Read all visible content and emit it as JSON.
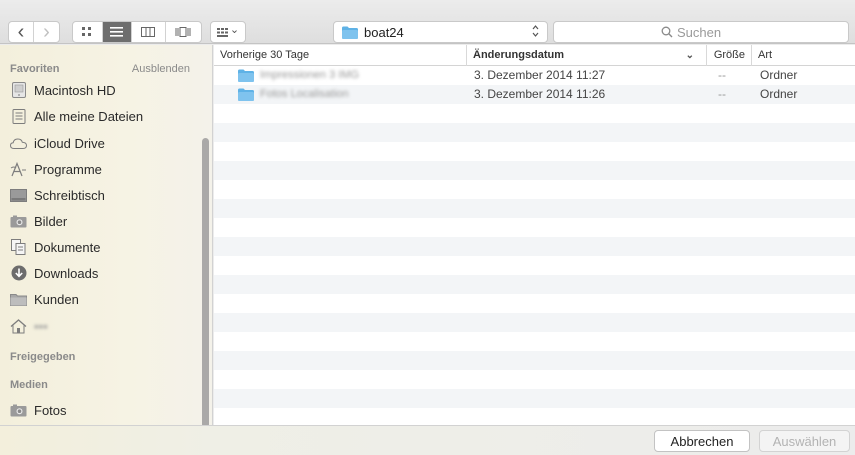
{
  "toolbar": {
    "back_glyph": "‹",
    "forward_glyph": "›",
    "view_icons": [
      "icon-view-icon",
      "list-view-icon",
      "column-view-icon",
      "coverflow-view-icon"
    ],
    "arrange_icon": "arrange-icon",
    "arrange_chevron": "⌄",
    "location": "boat24",
    "location_updown": "⌃⌄",
    "search_placeholder": "Suchen"
  },
  "sidebar": {
    "favorites_header": "Favoriten",
    "hide_label": "Ausblenden",
    "favorites": [
      {
        "label": "Macintosh HD",
        "icon": "hard-drive-icon"
      },
      {
        "label": "Alle meine Dateien",
        "icon": "all-files-icon"
      },
      {
        "label": "iCloud Drive",
        "icon": "cloud-icon"
      },
      {
        "label": "Programme",
        "icon": "applications-icon"
      },
      {
        "label": "Schreibtisch",
        "icon": "desktop-icon"
      },
      {
        "label": "Bilder",
        "icon": "camera-icon"
      },
      {
        "label": "Dokumente",
        "icon": "documents-icon"
      },
      {
        "label": "Downloads",
        "icon": "downloads-icon"
      },
      {
        "label": "Kunden",
        "icon": "folder-icon"
      },
      {
        "label": "•••",
        "icon": "home-icon"
      }
    ],
    "shared_header": "Freigegeben",
    "media_header": "Medien",
    "media": [
      {
        "label": "Fotos",
        "icon": "camera-icon"
      }
    ]
  },
  "filelist": {
    "columns": {
      "name": "Vorherige 30 Tage",
      "date": "Änderungsdatum",
      "sort_indicator": "⌄",
      "size": "Größe",
      "kind": "Art"
    },
    "rows": [
      {
        "name": "Impressionen 3 IMG",
        "date": "3. Dezember 2014 11:27",
        "size": "--",
        "kind": "Ordner"
      },
      {
        "name": "Fotos Localisation",
        "date": "3. Dezember 2014 11:26",
        "size": "--",
        "kind": "Ordner"
      }
    ]
  },
  "footer": {
    "cancel_label": "Abbrechen",
    "choose_label": "Auswählen"
  },
  "colors": {
    "folder_blue": "#5fb2e6",
    "active_view": "#6e6e6e"
  }
}
